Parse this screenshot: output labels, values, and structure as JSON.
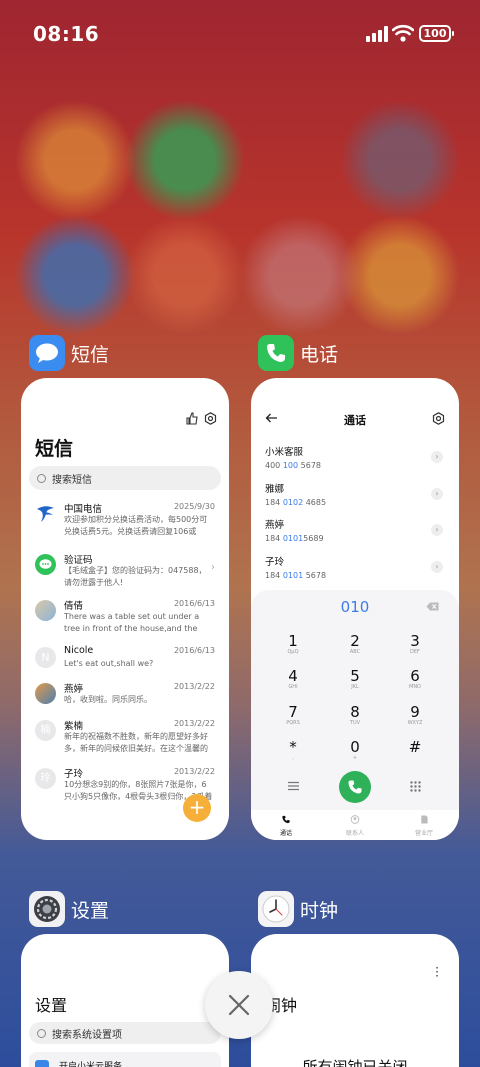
{
  "status": {
    "time": "08:16",
    "battery": "100"
  },
  "apps": {
    "messages": {
      "label": "短信",
      "title": "短信",
      "search_placeholder": "搜索短信",
      "conversations": [
        {
          "name": "中国电信",
          "date": "2025/9/30",
          "text": "欢迎参加积分兑换话费活动，每500分可兑换话费5元。兑换话费请回复106或jfdh#话费…"
        },
        {
          "name": "验证码",
          "date": "",
          "text": "【毛绒盒子】您的验证码为：047588，请勿泄露于他人!"
        },
        {
          "name": "倩倩",
          "date": "2016/6/13",
          "text": "There was a table set out under a tree in front of the house,and the March Hare an…"
        },
        {
          "name": "Nicole",
          "date": "2016/6/13",
          "text": "Let's eat out,shall we?"
        },
        {
          "name": "燕婷",
          "date": "2013/2/22",
          "text": "哈，收到啦。同乐同乐。"
        },
        {
          "name": "紫楠",
          "date": "2013/2/22",
          "text": "新年的祝福数不胜数，新年的愿望好多好多，新年的问候依旧美好。在这个温馨的时刻，…"
        },
        {
          "name": "子玲",
          "date": "2013/2/22",
          "text": "10分想念9别的你，8张照片7张是你，6只小狗5只像你，4根骨头3根归你，2爪着地1定…"
        }
      ],
      "avatar_initials": {
        "nicole": "N",
        "zinan": "楠",
        "ziling": "玲"
      }
    },
    "phone": {
      "label": "电话",
      "title": "通话",
      "contacts": [
        {
          "name": "小米客服",
          "pre": "400 ",
          "hl": "100",
          "post": " 5678"
        },
        {
          "name": "雅娜",
          "pre": "184 ",
          "hl": "0102",
          "post": " 4685"
        },
        {
          "name": "燕婷",
          "pre": "184 ",
          "hl": "0101",
          "post": "5689"
        },
        {
          "name": "子玲",
          "pre": "184 ",
          "hl": "0101",
          "post": " 5678"
        }
      ],
      "dialed": "010",
      "keys": [
        {
          "d": "1",
          "l": "QμQ"
        },
        {
          "d": "2",
          "l": "ABC"
        },
        {
          "d": "3",
          "l": "DEF"
        },
        {
          "d": "4",
          "l": "GHI"
        },
        {
          "d": "5",
          "l": "JKL"
        },
        {
          "d": "6",
          "l": "MNO"
        },
        {
          "d": "7",
          "l": "PQRS"
        },
        {
          "d": "8",
          "l": "TUV"
        },
        {
          "d": "9",
          "l": "WXYZ"
        },
        {
          "d": "*",
          "l": ","
        },
        {
          "d": "0",
          "l": "+"
        },
        {
          "d": "#",
          "l": ""
        }
      ],
      "tabs": [
        "通话",
        "联系人",
        "营业厅"
      ]
    },
    "settings": {
      "label": "设置",
      "title": "设置",
      "search_placeholder": "搜索系统设置项",
      "first_item": "开启小米云服务"
    },
    "clock": {
      "label": "时钟",
      "title": "闹钟",
      "status": "所有闹钟已关闭"
    }
  },
  "colors": {
    "accent_blue": "#3b7de6",
    "call_green": "#2fb15a",
    "fab_orange": "#f6b03a"
  }
}
